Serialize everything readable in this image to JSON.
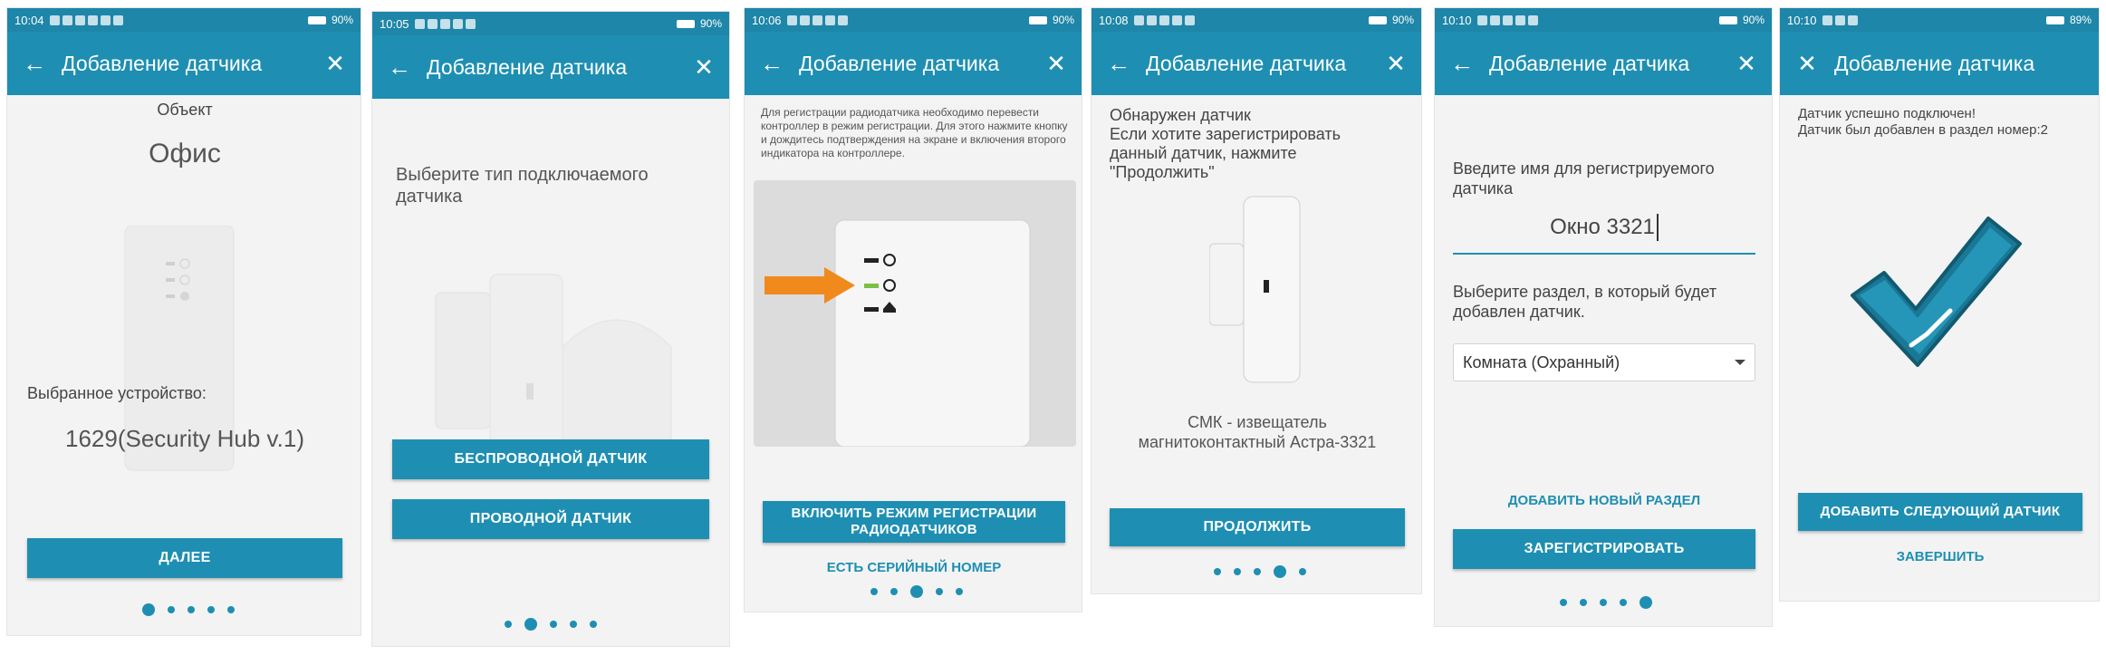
{
  "common": {
    "title": "Добавление датчика",
    "battery": "90%"
  },
  "screens": [
    {
      "time": "10:04",
      "battery": "90%",
      "object_label": "Объект",
      "object_value": "Офис",
      "device_label": "Выбранное устройство:",
      "device_value": "1629(Security Hub v.1)",
      "next_button": "ДАЛЕЕ",
      "active_dot": 1
    },
    {
      "time": "10:05",
      "battery": "90%",
      "prompt": "Выберите тип подключаемого датчика",
      "wireless_button": "БЕСПРОВОДНОЙ ДАТЧИК",
      "wired_button": "ПРОВОДНОЙ ДАТЧИК",
      "active_dot": 2
    },
    {
      "time": "10:06",
      "battery": "90%",
      "instructions": "Для регистрации радиодатчика необходимо перевести контроллер в режим регистрации. Для этого нажмите кнопку и дождитесь подтверждения на экране и включения второго индикатора на контроллере.",
      "register_mode_button": "ВКЛЮЧИТЬ РЕЖИМ РЕГИСТРАЦИИ РАДИОДАТЧИКОВ",
      "serial_link": "ЕСТЬ СЕРИЙНЫЙ НОМЕР",
      "active_dot": 3
    },
    {
      "time": "10:08",
      "battery": "90%",
      "found_text": "Обнаружен датчик\nЕсли хотите зарегистрировать данный датчик, нажмите \"Продолжить\"",
      "sensor_name": "СМК - извещатель магнитоконтактный Астра-3321",
      "continue_button": "ПРОДОЛЖИТЬ",
      "active_dot": 4
    },
    {
      "time": "10:10",
      "battery": "90%",
      "name_prompt": "Введите имя для регистрируемого датчика",
      "name_value": "Окно 3321",
      "section_prompt": "Выберите раздел, в который будет добавлен датчик.",
      "section_value": "Комната (Охранный)",
      "add_section_link": "ДОБАВИТЬ НОВЫЙ РАЗДЕЛ",
      "register_button": "ЗАРЕГИСТРИРОВАТЬ",
      "active_dot": 5
    },
    {
      "time": "10:10",
      "battery": "89%",
      "success_text": "Датчик успешно подключен!\nДатчик был добавлен в раздел номер:2",
      "add_next_button": "ДОБАВИТЬ СЛЕДУЮЩИЙ ДАТЧИК",
      "finish_link": "ЗАВЕРШИТЬ"
    }
  ],
  "colors": {
    "primary": "#1e8fb2",
    "statusbar": "#1e86a8",
    "background": "#f3f3f3",
    "arrow": "#f08a1c",
    "led_green": "#7ac143"
  },
  "icons": [
    "back-arrow-icon",
    "close-icon",
    "dropdown-arrow-icon",
    "checkmark-icon"
  ]
}
